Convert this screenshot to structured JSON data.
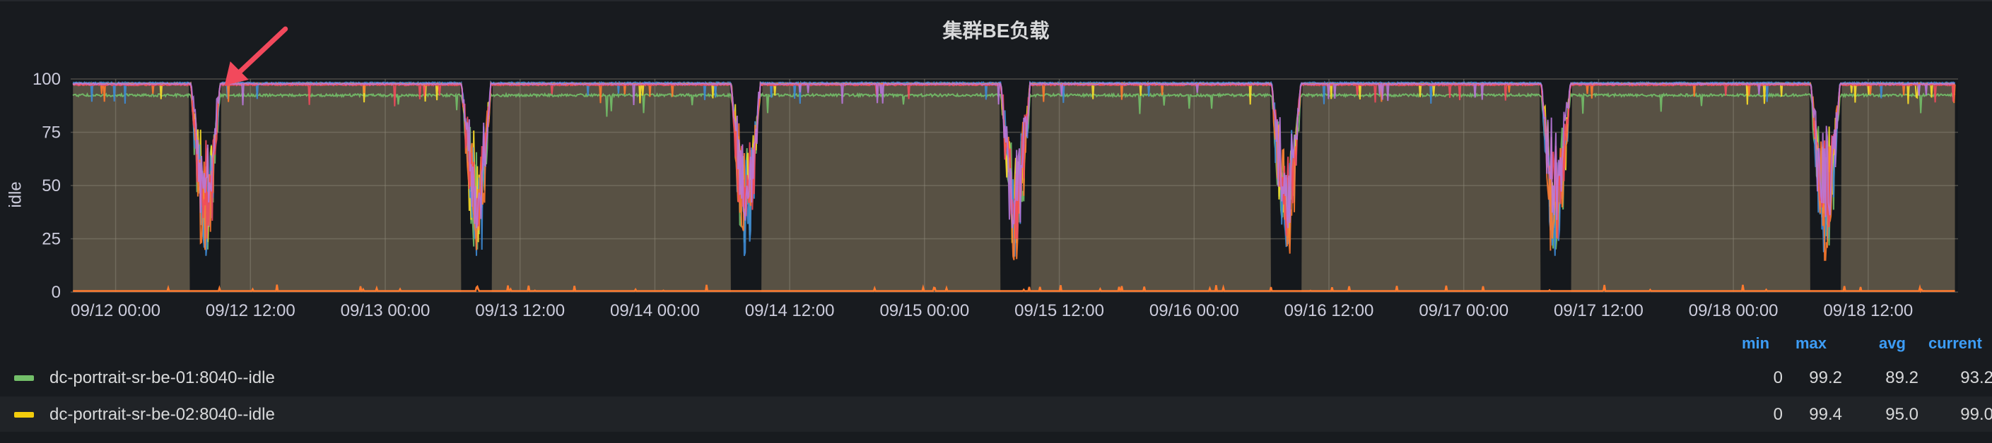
{
  "panel": {
    "title": "集群BE负载"
  },
  "chart_data": {
    "type": "line",
    "ylabel": "idle",
    "ylim": [
      0,
      100
    ],
    "y_ticks": [
      "0",
      "25",
      "50",
      "75",
      "100"
    ],
    "x_ticks": [
      "09/12 00:00",
      "09/12 12:00",
      "09/13 00:00",
      "09/13 12:00",
      "09/14 00:00",
      "09/14 12:00",
      "09/15 00:00",
      "09/15 12:00",
      "09/16 00:00",
      "09/16 12:00",
      "09/17 00:00",
      "09/17 12:00",
      "09/18 00:00",
      "09/18 12:00"
    ],
    "x_hours": [
      0,
      12,
      24,
      36,
      48,
      60,
      72,
      84,
      96,
      108,
      120,
      132,
      144,
      156
    ],
    "x_range_hours": [
      -4,
      164
    ],
    "grid": true,
    "series": [
      {
        "name": "dc-portrait-sr-be-01:8040--idle",
        "color": "#73bf69",
        "baseline": 93,
        "dip_min": 25
      },
      {
        "name": "dc-portrait-sr-be-02:8040--idle",
        "color": "#fade2a",
        "baseline": 98,
        "dip_min": 28
      },
      {
        "color": "#3d8bd6",
        "baseline": 98.5,
        "dip_min": 22
      },
      {
        "color": "#ff7a2e",
        "baseline": 98,
        "dip_min": 20
      },
      {
        "color": "#f2495c",
        "baseline": 97.5,
        "dip_min": 30
      },
      {
        "color": "#b877d9",
        "baseline": 98,
        "dip_min": 35
      }
    ],
    "dips_start_hours": [
      6.7,
      30.8,
      54.8,
      78.8,
      102.9,
      126.9,
      150.9
    ],
    "dip_width_hours": 2.6,
    "fill_color": "#5c5447"
  },
  "legend": {
    "headers": {
      "min": "min",
      "max": "max",
      "avg": "avg",
      "current": "current"
    },
    "rows": [
      {
        "name": "dc-portrait-sr-be-01:8040--idle",
        "color": "#73bf69",
        "min": "0",
        "max": "99.2",
        "avg": "89.2",
        "current": "93.2"
      },
      {
        "name": "dc-portrait-sr-be-02:8040--idle",
        "color": "#f2cc0c",
        "min": "0",
        "max": "99.4",
        "avg": "95.0",
        "current": "99.0"
      }
    ]
  },
  "annotation": {
    "arrow_color": "#f2495c"
  }
}
